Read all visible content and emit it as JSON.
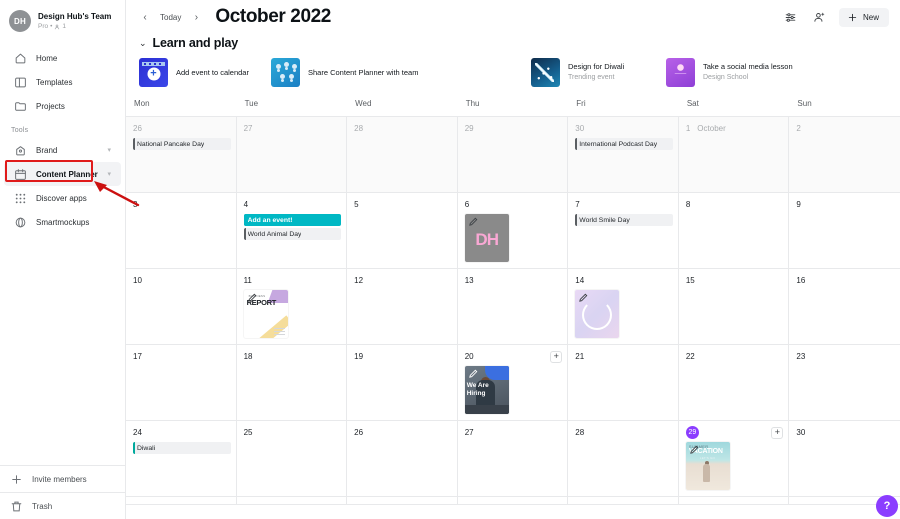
{
  "sidebar": {
    "team": {
      "initials": "DH",
      "name": "Design Hub's Team",
      "plan": "Pro",
      "members": "1",
      "sep": "•"
    },
    "nav": [
      {
        "label": "Home",
        "icon": "home-icon"
      },
      {
        "label": "Templates",
        "icon": "templates-icon"
      },
      {
        "label": "Projects",
        "icon": "folder-icon"
      }
    ],
    "tools_label": "Tools",
    "tools": [
      {
        "label": "Brand",
        "icon": "brand-icon",
        "chevron": "▾",
        "active": false
      },
      {
        "label": "Content Planner",
        "icon": "calendar-icon",
        "chevron": "▾",
        "active": true
      },
      {
        "label": "Discover apps",
        "icon": "apps-grid-icon",
        "chevron": "",
        "active": false
      },
      {
        "label": "Smartmockups",
        "icon": "smartmockups-icon",
        "chevron": "",
        "active": false
      }
    ],
    "bottom": [
      {
        "label": "Invite members",
        "icon": "plus-icon"
      },
      {
        "label": "Trash",
        "icon": "trash-icon"
      }
    ]
  },
  "header": {
    "prev": "‹",
    "today": "Today",
    "next": "›",
    "month_title": "October 2022",
    "filter_icon": "filter-icon",
    "share_icon": "share-people-icon",
    "new_label": "New",
    "new_plus": "+"
  },
  "learn_and_play": {
    "chevron": "⌄",
    "title": "Learn and play",
    "cards": [
      {
        "title": "Add event to calendar",
        "sub": "",
        "thumb": "calendar-add-thumb"
      },
      {
        "title": "Share Content Planner with team",
        "sub": "",
        "thumb": "team-thumb"
      },
      {
        "title": "Design for Diwali",
        "sub": "Trending event",
        "thumb": "diwali-thumb"
      },
      {
        "title": "Take a social media lesson",
        "sub": "Design School",
        "thumb": "design-school-thumb"
      }
    ]
  },
  "calendar": {
    "day_names": [
      "Mon",
      "Tue",
      "Wed",
      "Thu",
      "Fri",
      "Sat",
      "Sun"
    ],
    "month_marker": "October",
    "today_number": "29",
    "add_icon": "+",
    "weeks": [
      [
        {
          "num": "26",
          "out": true,
          "events": [
            {
              "text": "National Pancake Day",
              "style": "grey"
            }
          ]
        },
        {
          "num": "27",
          "out": true,
          "events": []
        },
        {
          "num": "28",
          "out": true,
          "events": []
        },
        {
          "num": "29",
          "out": true,
          "events": []
        },
        {
          "num": "30",
          "out": true,
          "events": [
            {
              "text": "International Podcast Day",
              "style": "grey"
            }
          ]
        },
        {
          "num": "1",
          "out": true,
          "month": "October",
          "events": []
        },
        {
          "num": "2",
          "out": true,
          "events": []
        }
      ],
      [
        {
          "num": "3",
          "out": false,
          "events": []
        },
        {
          "num": "4",
          "out": false,
          "events": [
            {
              "text": "Add an event!",
              "style": "teal"
            },
            {
              "text": "World Animal Day",
              "style": "grey"
            }
          ]
        },
        {
          "num": "5",
          "out": false,
          "events": []
        },
        {
          "num": "6",
          "out": false,
          "events": [],
          "thumb": "dh-design-thumb"
        },
        {
          "num": "7",
          "out": false,
          "events": [
            {
              "text": "World Smile Day",
              "style": "grey"
            }
          ]
        },
        {
          "num": "8",
          "out": false,
          "events": []
        },
        {
          "num": "9",
          "out": false,
          "events": []
        }
      ],
      [
        {
          "num": "10",
          "out": false,
          "events": []
        },
        {
          "num": "11",
          "out": false,
          "events": [],
          "thumb": "report-design-thumb"
        },
        {
          "num": "12",
          "out": false,
          "events": []
        },
        {
          "num": "13",
          "out": false,
          "events": []
        },
        {
          "num": "14",
          "out": false,
          "events": [],
          "thumb": "ring-design-thumb"
        },
        {
          "num": "15",
          "out": false,
          "events": []
        },
        {
          "num": "16",
          "out": false,
          "events": []
        }
      ],
      [
        {
          "num": "17",
          "out": false,
          "events": []
        },
        {
          "num": "18",
          "out": false,
          "events": []
        },
        {
          "num": "19",
          "out": false,
          "events": []
        },
        {
          "num": "20",
          "out": false,
          "add": true,
          "events": [],
          "thumb": "hiring-design-thumb"
        },
        {
          "num": "21",
          "out": false,
          "events": []
        },
        {
          "num": "22",
          "out": false,
          "events": []
        },
        {
          "num": "23",
          "out": false,
          "events": []
        }
      ],
      [
        {
          "num": "24",
          "out": false,
          "events": [
            {
              "text": "Diwali",
              "style": "diwali"
            }
          ]
        },
        {
          "num": "25",
          "out": false,
          "events": []
        },
        {
          "num": "26",
          "out": false,
          "events": []
        },
        {
          "num": "27",
          "out": false,
          "events": []
        },
        {
          "num": "28",
          "out": false,
          "events": []
        },
        {
          "num": "29",
          "out": false,
          "today": true,
          "add": true,
          "events": [],
          "thumb": "beach-design-thumb"
        },
        {
          "num": "30",
          "out": false,
          "events": []
        }
      ]
    ]
  },
  "help": {
    "label": "?"
  },
  "annotation": {
    "target": "Content Planner",
    "box_color": "#e01b1b",
    "arrow_color": "#cc1111"
  },
  "colors": {
    "accent_purple": "#8b3dff",
    "event_teal": "#00b8c4",
    "diwali_green": "#00a99d",
    "border": "#e8e9eb",
    "out_of_month_bg": "#fafafa"
  }
}
